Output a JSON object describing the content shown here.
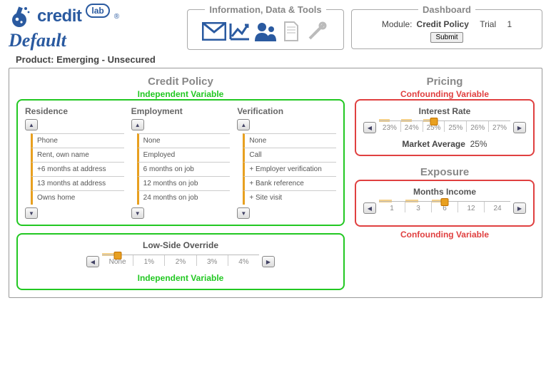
{
  "app": {
    "logo_text": "credit",
    "logo_lab": "lab",
    "mode_label": "Default"
  },
  "tools": {
    "title": "Information, Data & Tools",
    "icons": [
      "mail-icon",
      "trend-chart-icon",
      "people-icon",
      "document-icon",
      "wrench-icon"
    ]
  },
  "dashboard": {
    "title": "Dashboard",
    "module_label": "Module:",
    "module_value": "Credit Policy",
    "trial_label": "Trial",
    "trial_value": "1",
    "submit_label": "Submit"
  },
  "product": {
    "label": "Product:",
    "value": "Emerging - Unsecured"
  },
  "credit_policy": {
    "title": "Credit Policy",
    "independent_label": "Independent Variable",
    "criteria": [
      {
        "name": "Residence",
        "selected_index": 4,
        "options": [
          "Phone",
          "Rent, own name",
          "+6 months at address",
          "13 months at address",
          "Owns home"
        ]
      },
      {
        "name": "Employment",
        "selected_index": 4,
        "options": [
          "None",
          "Employed",
          "6 months on job",
          "12 months on job",
          "24 months on job"
        ]
      },
      {
        "name": "Verification",
        "selected_index": 4,
        "options": [
          "None",
          "Call",
          "+ Employer verification",
          "+ Bank reference",
          "+ Site visit"
        ]
      }
    ]
  },
  "override": {
    "title": "Low-Side Override",
    "options": [
      "None",
      "1%",
      "2%",
      "3%",
      "4%"
    ],
    "selected_index": 0,
    "independent_label": "Independent Variable"
  },
  "pricing": {
    "title": "Pricing",
    "confounding_label": "Confounding Variable",
    "rate_label": "Interest Rate",
    "options": [
      "23%",
      "24%",
      "25%",
      "25%",
      "26%",
      "27%"
    ],
    "selected_index": 2,
    "market_avg_label": "Market Average",
    "market_avg_value": "25%"
  },
  "exposure": {
    "title": "Exposure",
    "confounding_label": "Confounding Variable",
    "months_label": "Months Income",
    "options": [
      "1",
      "3",
      "6",
      "12",
      "24"
    ],
    "selected_index": 2
  }
}
